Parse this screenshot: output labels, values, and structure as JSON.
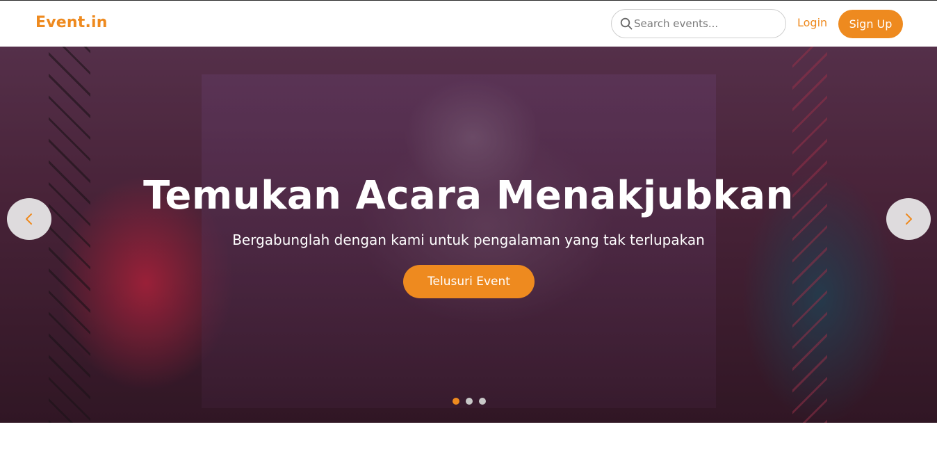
{
  "header": {
    "brand": "Event.in",
    "search": {
      "placeholder": "Search events..."
    },
    "login_label": "Login",
    "signup_label": "Sign Up"
  },
  "hero": {
    "title": "Temukan Acara Menakjubkan",
    "subtitle": "Bergabunglah dengan kami untuk pengalaman yang tak terlupakan",
    "cta_label": "Telusuri Event",
    "slides_total": 3,
    "active_slide": 1
  },
  "next_section": {
    "title_partial": ""
  },
  "colors": {
    "accent": "#ee8a1f",
    "text_light": "#ffffff"
  },
  "icons": [
    "search-icon",
    "chevron-left-icon",
    "chevron-right-icon"
  ]
}
